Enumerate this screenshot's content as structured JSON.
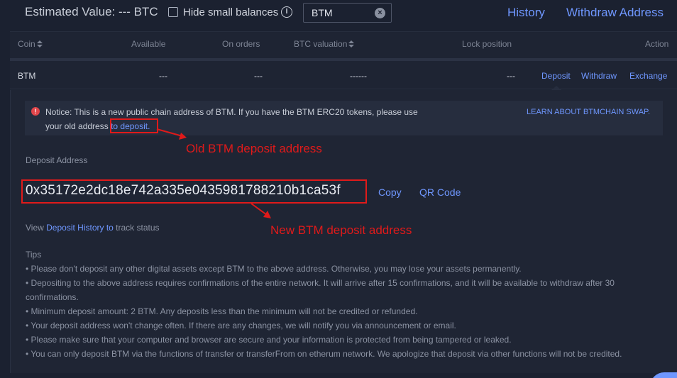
{
  "header": {
    "estimated_value": "Estimated Value: --- BTC",
    "hide_small_label": "Hide small balances",
    "search_value": "BTM",
    "history_link": "History",
    "withdraw_address_link": "Withdraw Address"
  },
  "table": {
    "columns": [
      "Coin",
      "Available",
      "On orders",
      "BTC valuation",
      "Lock position",
      "Action"
    ],
    "row": {
      "coin": "BTM",
      "available": "---",
      "on_orders": "---",
      "btc_valuation": "------",
      "lock_position": "---",
      "actions": [
        "Deposit",
        "Withdraw",
        "Exchange"
      ]
    }
  },
  "notice": {
    "line1": "Notice: This is a new public chain address of BTM. If you have the BTM ERC20 tokens, please use",
    "line2_prefix": "your old address ",
    "line2_link": "to deposit.",
    "learn_link": "LEARN ABOUT BTMCHAIN SWAP."
  },
  "deposit": {
    "label": "Deposit Address",
    "address": "0x35172e2dc18e742a335e0435981788210b1ca53f",
    "copy": "Copy",
    "qr_code": "QR Code",
    "view_prefix": "View ",
    "view_link": "Deposit History to",
    "view_suffix": " track status"
  },
  "annotations": {
    "old_address": "Old BTM deposit address",
    "new_address": "New BTM deposit address",
    "color": "#e01a1a"
  },
  "tips": {
    "title": "Tips",
    "items": [
      "• Please don't deposit any other digital assets except BTM to the above address. Otherwise, you may lose your assets permanently.",
      "• Depositing to the above address requires confirmations of the entire network. It will arrive after 15 confirmations, and it will be available to withdraw after 30",
      "confirmations.",
      "• Minimum deposit amount: 2 BTM. Any deposits less than the minimum will not be credited or refunded.",
      "• Your deposit address won't change often. If there are any changes, we will notify you via announcement or email.",
      "• Please make sure that your computer and browser are secure and your information is protected from being tampered or leaked.",
      "• You can only deposit BTM via the functions of transfer or transferFrom on etherum network. We apologize that deposit via other functions will not be credited."
    ]
  },
  "colors": {
    "background": "#1b2130",
    "link": "#6f97ff",
    "panel": "#1f2534"
  }
}
